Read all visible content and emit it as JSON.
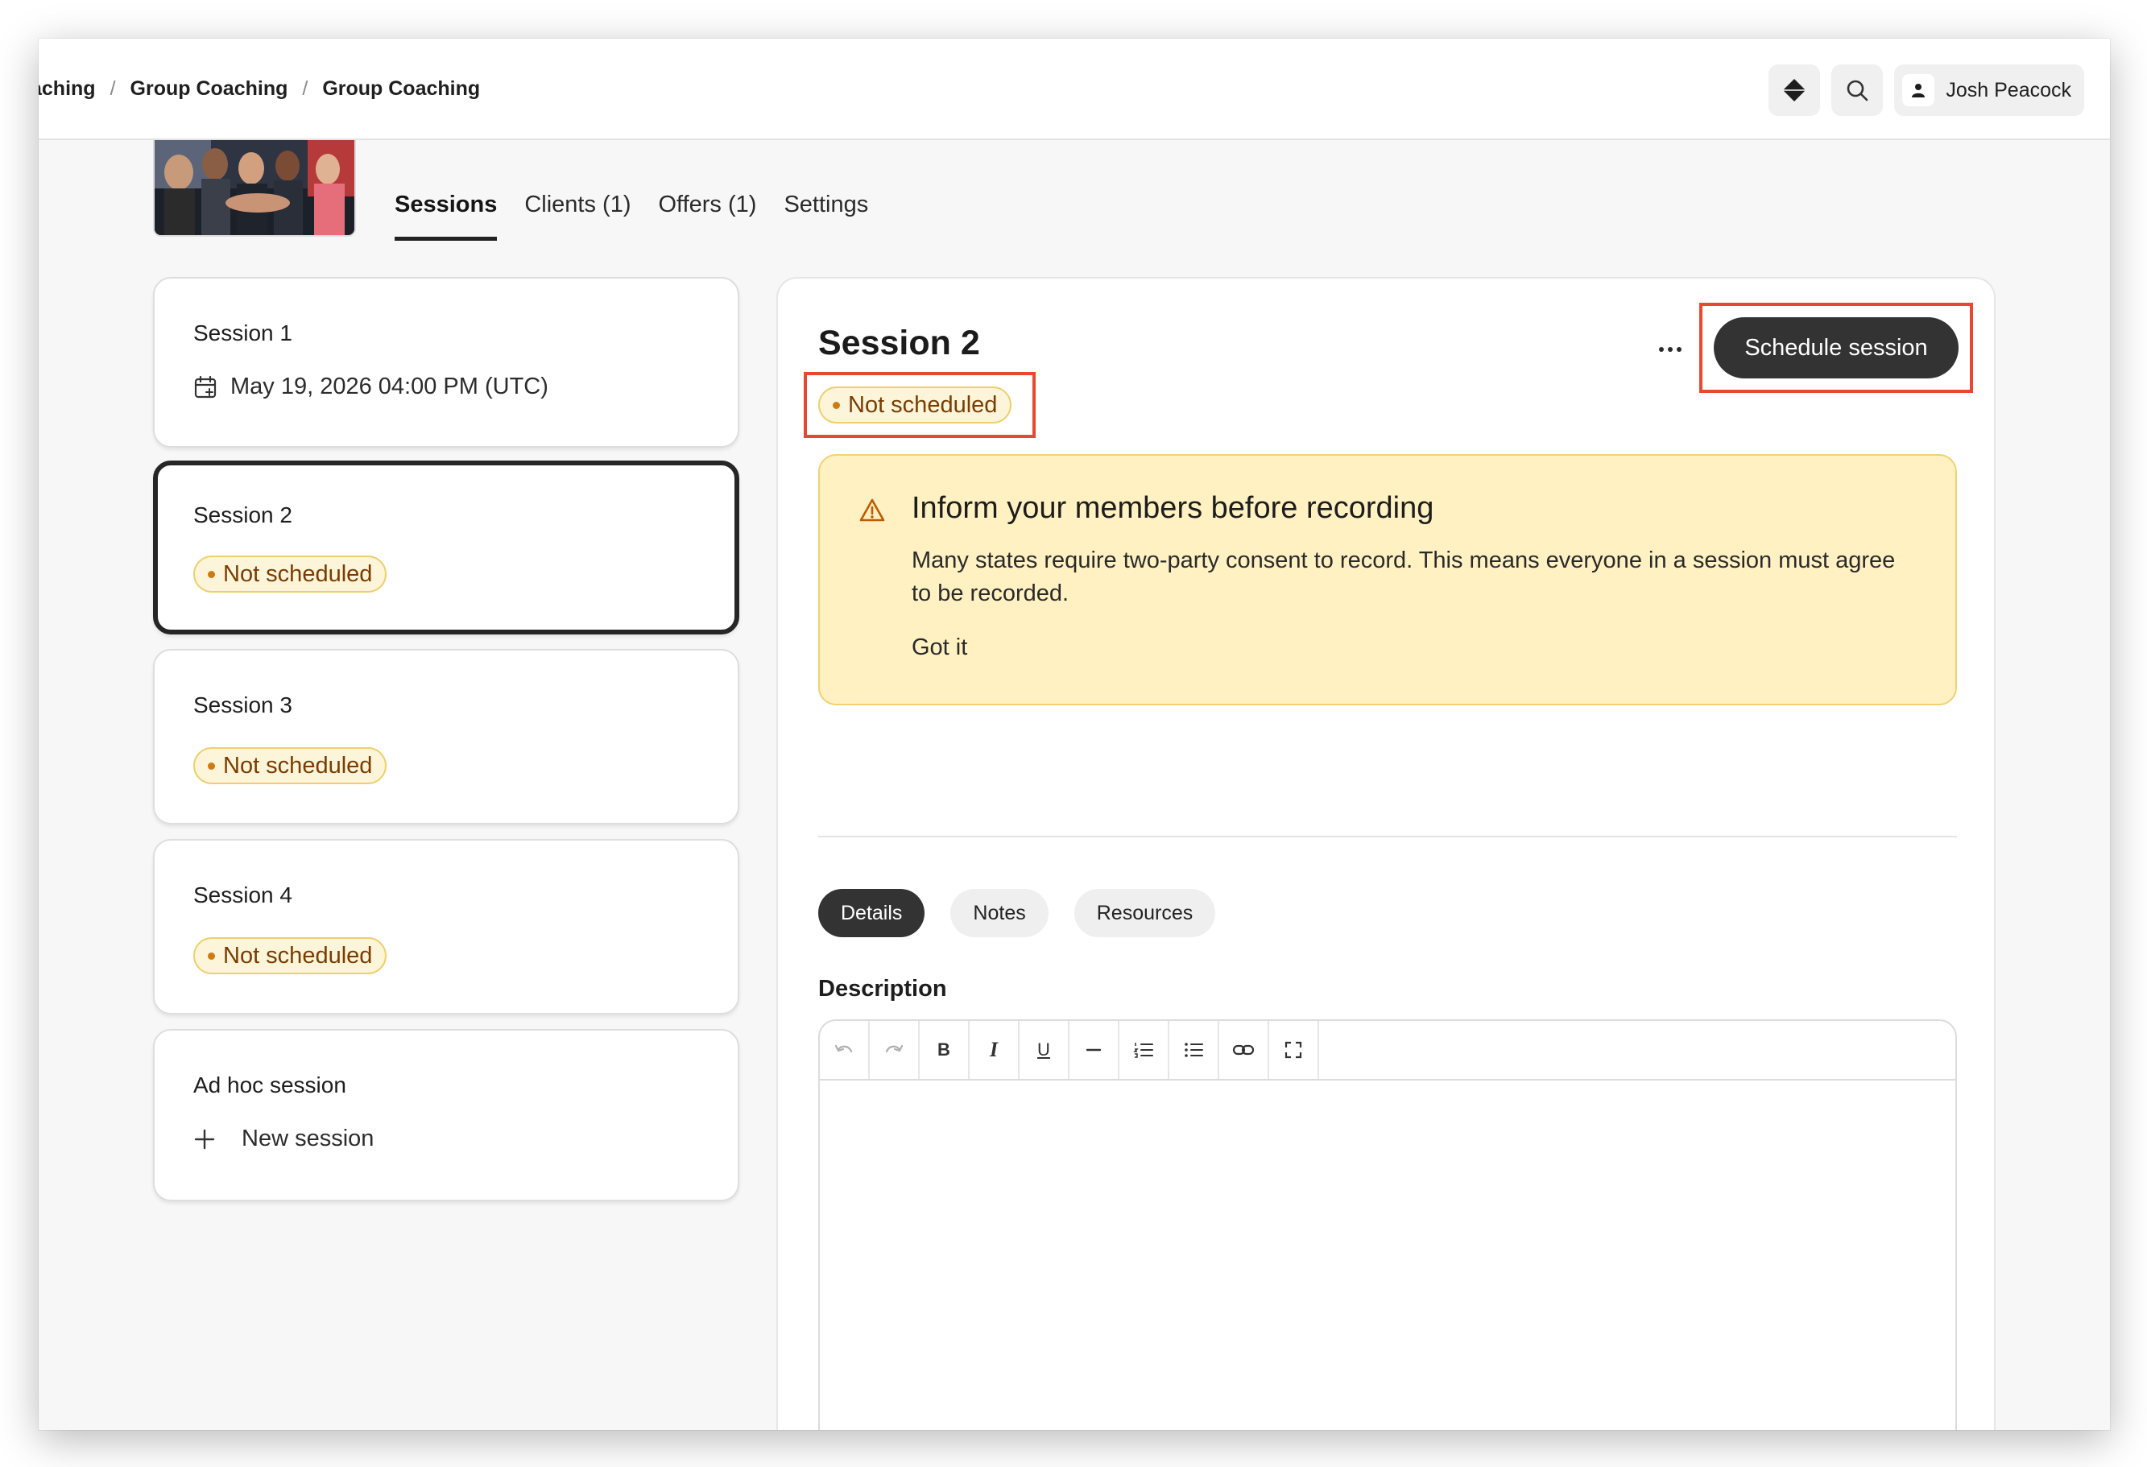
{
  "breadcrumb": {
    "items": [
      "aching",
      "Group Coaching",
      "Group Coaching"
    ],
    "separator": "/"
  },
  "header": {
    "user_name": "Josh Peacock",
    "tabs": [
      {
        "label": "Sessions",
        "active": true
      },
      {
        "label": "Clients (1)",
        "active": false
      },
      {
        "label": "Offers (1)",
        "active": false
      },
      {
        "label": "Settings",
        "active": false
      }
    ]
  },
  "sessions": [
    {
      "title": "Session 1",
      "date": "May 19, 2026 04:00 PM (UTC)"
    },
    {
      "title": "Session 2",
      "status": "Not scheduled"
    },
    {
      "title": "Session 3",
      "status": "Not scheduled"
    },
    {
      "title": "Session 4",
      "status": "Not scheduled"
    },
    {
      "title": "Ad hoc session",
      "action": "New session"
    }
  ],
  "detail": {
    "title": "Session 2",
    "status": "Not scheduled",
    "schedule_label": "Schedule session",
    "alert": {
      "title": "Inform your members before recording",
      "body": "Many states require two-party consent to record. This means everyone in a session must agree to be recorded.",
      "action": "Got it"
    },
    "pills": [
      {
        "label": "Details",
        "active": true
      },
      {
        "label": "Notes",
        "active": false
      },
      {
        "label": "Resources",
        "active": false
      }
    ],
    "description_label": "Description",
    "toolbar": {
      "bold": "B",
      "italic": "I",
      "underline": "U"
    }
  },
  "colors": {
    "accent_dark": "#333333",
    "badge_bg": "#fdf5da",
    "badge_text": "#7a3c00",
    "alert_bg": "#fff1c2",
    "highlight": "#e8482e"
  }
}
